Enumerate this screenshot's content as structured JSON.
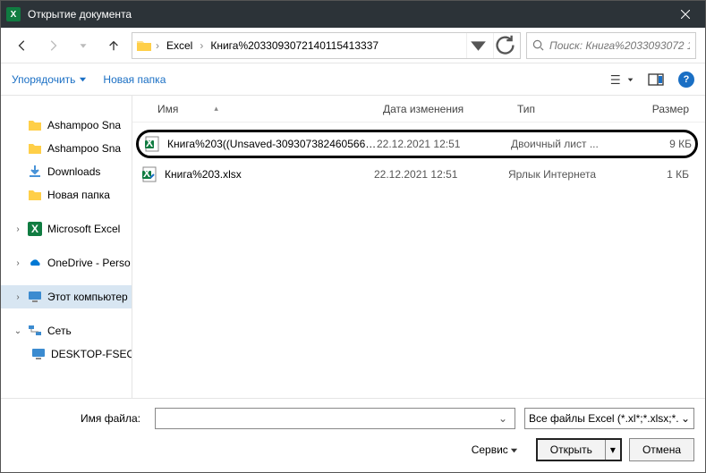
{
  "titlebar": {
    "title": "Открытие документа"
  },
  "nav": {
    "crumbs": [
      "Excel",
      "Книга%2033093072140115413337"
    ],
    "search_placeholder": "Поиск: Книга%2033093072 1..."
  },
  "toolbar": {
    "organize": "Упорядочить",
    "newfolder": "Новая папка"
  },
  "sidebar": {
    "items": [
      {
        "label": "Ashampoo Sna",
        "icon": "folder"
      },
      {
        "label": "Ashampoo Sna",
        "icon": "folder"
      },
      {
        "label": "Downloads",
        "icon": "dlfolder"
      },
      {
        "label": "Новая папка",
        "icon": "folder"
      },
      {
        "label": "Microsoft Excel",
        "icon": "excel",
        "expandable": true
      },
      {
        "label": "OneDrive - Perso",
        "icon": "onedrive",
        "expandable": true
      },
      {
        "label": "Этот компьютер",
        "icon": "pc",
        "expandable": true,
        "selected": true
      },
      {
        "label": "Сеть",
        "icon": "net",
        "expandable": true,
        "expanded": true
      },
      {
        "label": "DESKTOP-FSEO",
        "icon": "pc",
        "indent": true
      }
    ]
  },
  "columns": {
    "name": "Имя",
    "date": "Дата изменения",
    "type": "Тип",
    "size": "Размер"
  },
  "files": [
    {
      "name": "Книга%203((Unsaved-3093073824605660...",
      "date": "22.12.2021 12:51",
      "type": "Двоичный лист ...",
      "size": "9 КБ",
      "icon": "xlsb",
      "highlighted": true
    },
    {
      "name": "Книга%203.xlsx",
      "date": "22.12.2021 12:51",
      "type": "Ярлык Интернета",
      "size": "1 КБ",
      "icon": "xlsx"
    }
  ],
  "bottom": {
    "fname_label": "Имя файла:",
    "fname_value": "",
    "filter": "Все файлы Excel (*.xl*;*.xlsx;*.",
    "tools": "Сервис",
    "open": "Открыть",
    "cancel": "Отмена"
  }
}
